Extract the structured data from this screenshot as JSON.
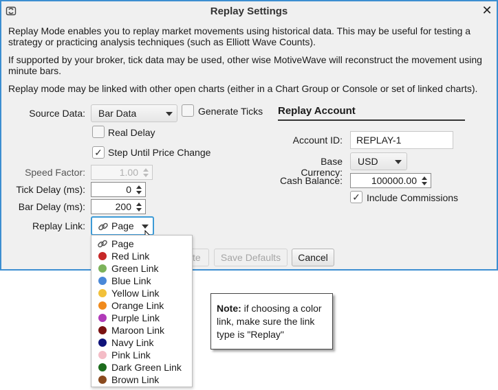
{
  "window": {
    "title": "Replay Settings",
    "close_glyph": "✕",
    "icon": "refresh-window-icon"
  },
  "description": {
    "p1": "Replay Mode enables you to replay market movements using historical data.  This may be useful for testing a strategy or practicing analysis techniques (such as Elliott Wave Counts).",
    "p2": "If supported by your broker, tick data may be used, other wise MotiveWave will reconstruct the movement using minute bars.",
    "p3": "Replay mode may be linked with other open charts (either in a Chart Group or Console or set of linked charts)."
  },
  "settings": {
    "source_data_label": "Source Data:",
    "source_data_value": "Bar Data",
    "generate_ticks_label": "Generate Ticks",
    "generate_ticks_checked": false,
    "real_delay_label": "Real Delay",
    "real_delay_checked": false,
    "step_until_label": "Step Until Price Change",
    "step_until_checked": true,
    "check_glyph": "✓",
    "speed_factor_label": "Speed Factor:",
    "speed_factor_value": "1.00",
    "tick_delay_label": "Tick Delay (ms):",
    "tick_delay_value": "0",
    "bar_delay_label": "Bar Delay (ms):",
    "bar_delay_value": "200",
    "replay_link_label": "Replay Link:",
    "replay_link_value": "Page"
  },
  "account": {
    "section_title": "Replay Account",
    "account_id_label": "Account ID:",
    "account_id_value": "REPLAY-1",
    "base_currency_label": "Base Currency:",
    "base_currency_value": "USD",
    "cash_balance_label": "Cash Balance:",
    "cash_balance_value": "100000.00",
    "include_commissions_label": "Include Commissions",
    "include_commissions_checked": true
  },
  "buttons": {
    "hidden_partial": "te",
    "save_defaults": "Save Defaults",
    "cancel": "Cancel"
  },
  "link_menu": {
    "items": [
      {
        "label": "Page",
        "icon": "link-chain-icon",
        "color": ""
      },
      {
        "label": "Red Link",
        "icon": "dot",
        "color": "#c62828"
      },
      {
        "label": "Green Link",
        "icon": "dot",
        "color": "#7cb25a"
      },
      {
        "label": "Blue Link",
        "icon": "dot",
        "color": "#4a88d8"
      },
      {
        "label": "Yellow Link",
        "icon": "dot",
        "color": "#f2c13a"
      },
      {
        "label": "Orange Link",
        "icon": "dot",
        "color": "#f08a1c"
      },
      {
        "label": "Purple Link",
        "icon": "dot",
        "color": "#b03ab8"
      },
      {
        "label": "Maroon Link",
        "icon": "dot",
        "color": "#7a1212"
      },
      {
        "label": "Navy Link",
        "icon": "dot",
        "color": "#0f137a"
      },
      {
        "label": "Pink Link",
        "icon": "dot",
        "color": "#f4bcc6"
      },
      {
        "label": "Dark Green Link",
        "icon": "dot",
        "color": "#1c6b1c"
      },
      {
        "label": "Brown Link",
        "icon": "dot",
        "color": "#8a4a1e"
      }
    ]
  },
  "callout": {
    "bold": "Note:",
    "text": " if choosing a color link, make sure the link type is \"Replay\""
  },
  "colors": {
    "window_border": "#3c8ed1",
    "dialog_bg": "#f0f0f0"
  }
}
